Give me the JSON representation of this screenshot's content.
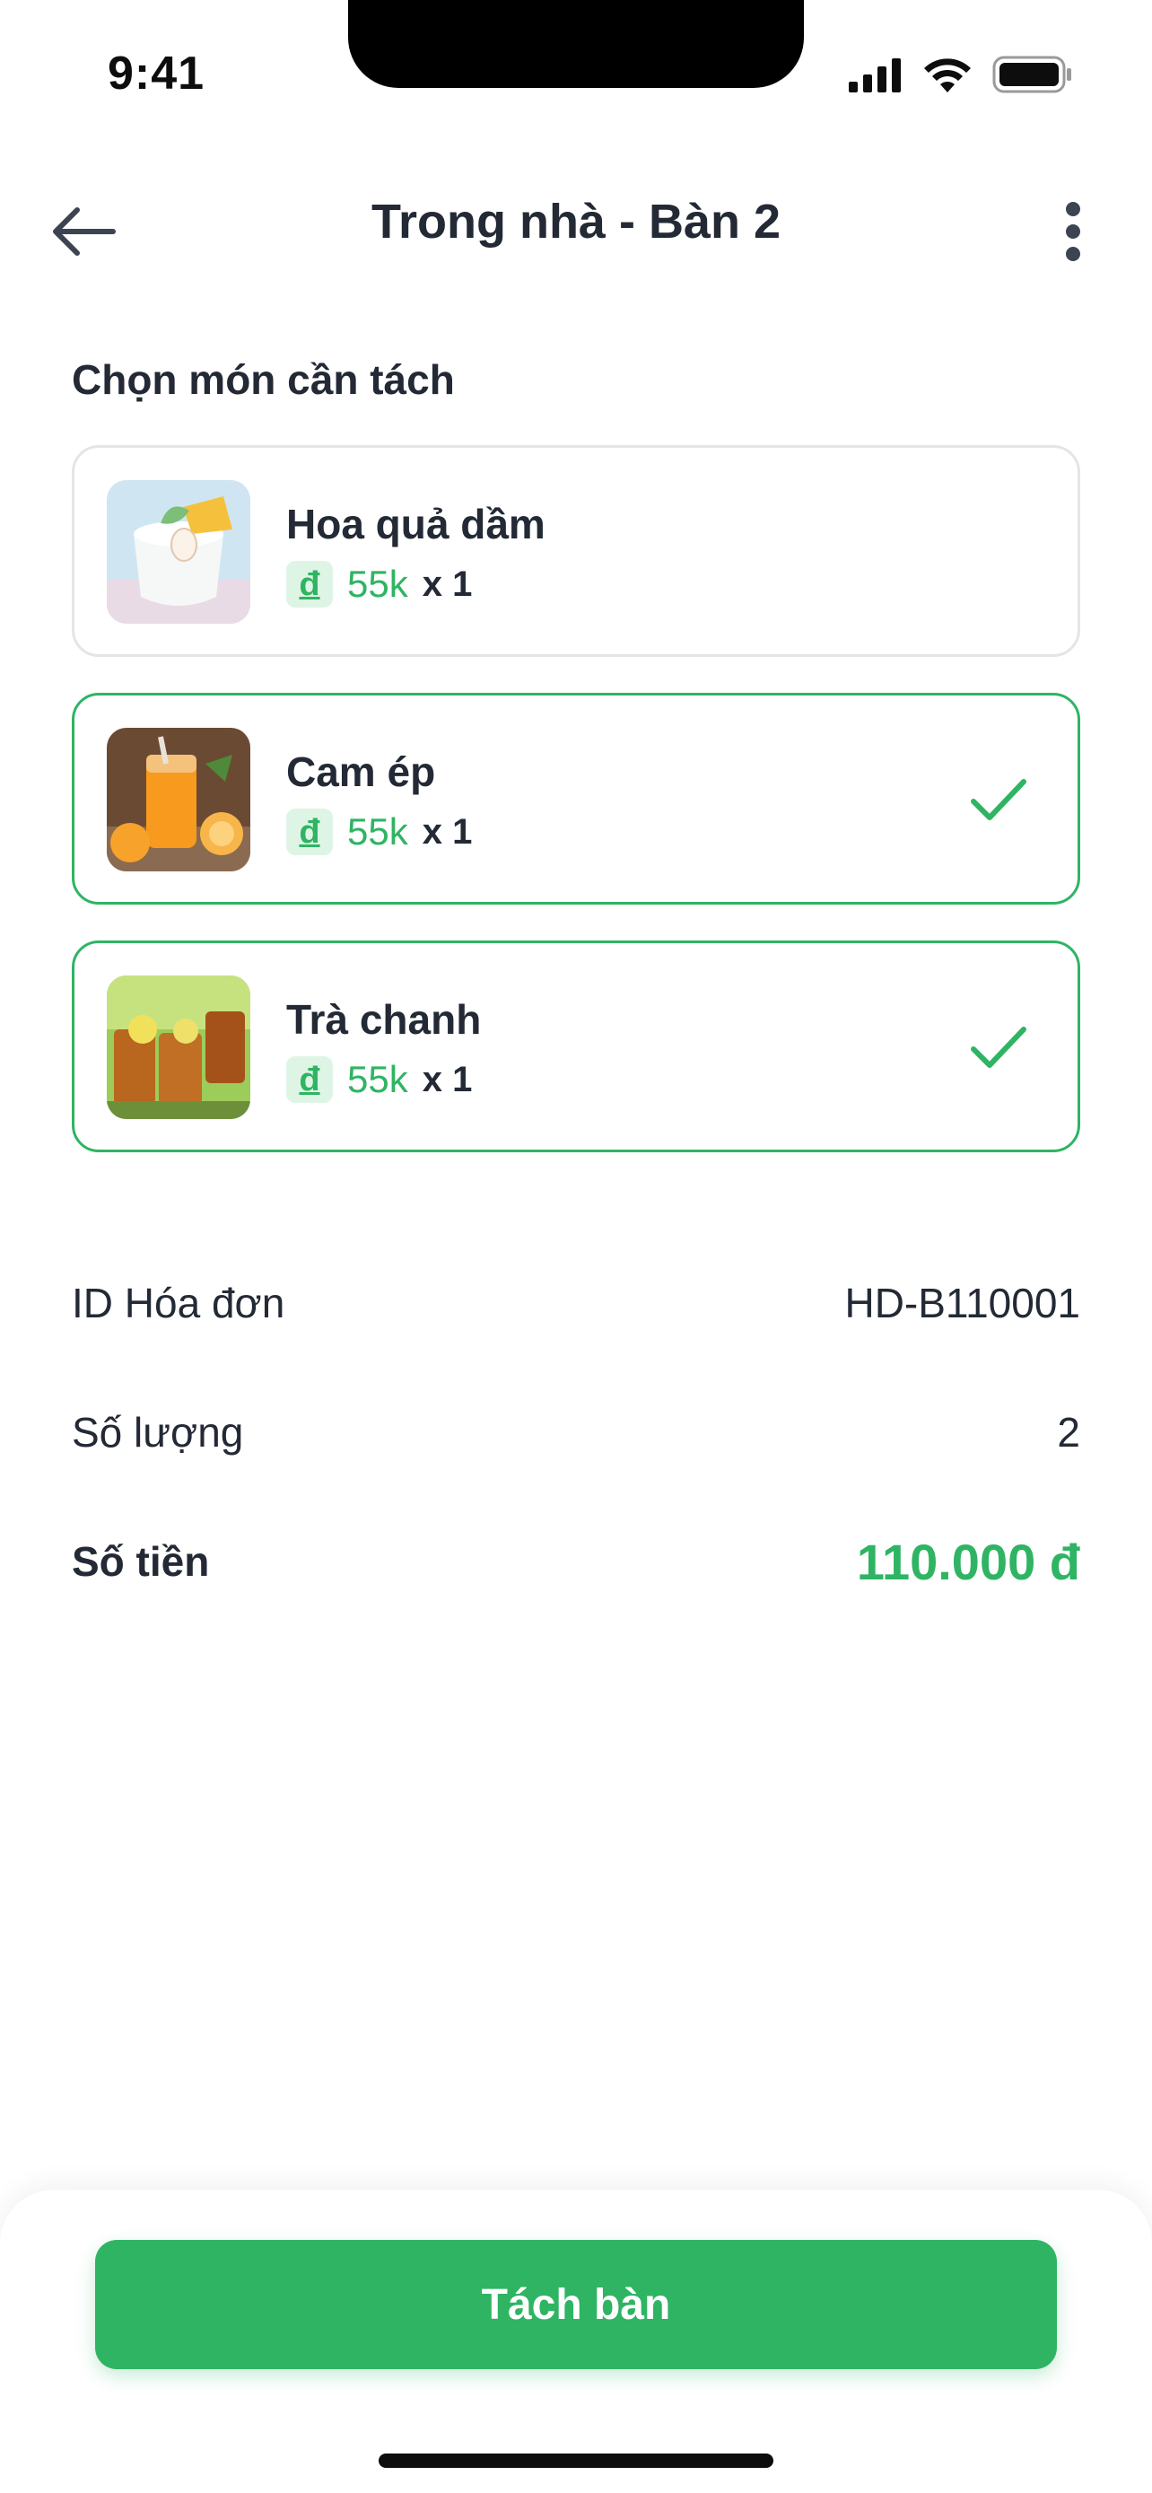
{
  "status_bar": {
    "time": "9:41"
  },
  "header": {
    "title": "Trong nhà - Bàn 2"
  },
  "section_title": "Chọn món cần tách",
  "currency_symbol": "đ",
  "items": [
    {
      "name": "Hoa quả dầm",
      "price": "55k",
      "qty": "x 1",
      "selected": false
    },
    {
      "name": "Cam ép",
      "price": "55k",
      "qty": "x 1",
      "selected": true
    },
    {
      "name": "Trà chanh",
      "price": "55k",
      "qty": "x 1",
      "selected": true
    }
  ],
  "summary": {
    "invoice_label": "ID Hóa đơn",
    "invoice_value": "HD-B110001",
    "quantity_label": "Số lượng",
    "quantity_value": "2",
    "amount_label": "Số tiền",
    "amount_value": "110.000 đ"
  },
  "action_button": "Tách bàn",
  "colors": {
    "accent": "#2fb463",
    "text": "#232a35",
    "border": "#e3e5e8"
  }
}
